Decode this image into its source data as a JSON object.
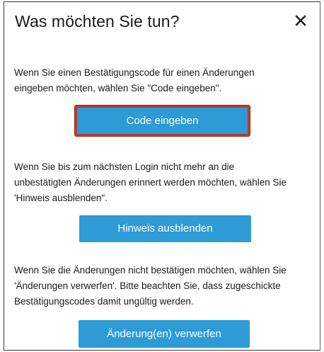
{
  "dialog": {
    "title": "Was möchten Sie tun?",
    "close_icon": "close-icon"
  },
  "sections": {
    "code": {
      "lines": [
        "Wenn Sie einen Bestätigungscode für einen Änderungen",
        "eingeben möchten, wählen Sie \"Code eingeben\"."
      ],
      "button_label": "Code eingeben"
    },
    "hint": {
      "lines": [
        "Wenn Sie bis zum nächsten Login nicht mehr an die",
        "unbestätigten Änderungen erinnert werden möchten, wählen Sie",
        "'Hinweis ausblenden\"."
      ],
      "button_label": "Hinweis ausblenden"
    },
    "discard": {
      "lines": [
        "Wenn Sie die Änderungen nicht bestätigen möchten, wählen Sie",
        "'Änderungen verwerfen'. Bitte beachten Sie, dass zugeschickte",
        "Bestätigungscodes damit ungültig werden."
      ],
      "button_label": "Änderung(en) verwerfen"
    }
  },
  "colors": {
    "button_blue": "#2c9bd6",
    "focus_border": "#c23a2a"
  }
}
